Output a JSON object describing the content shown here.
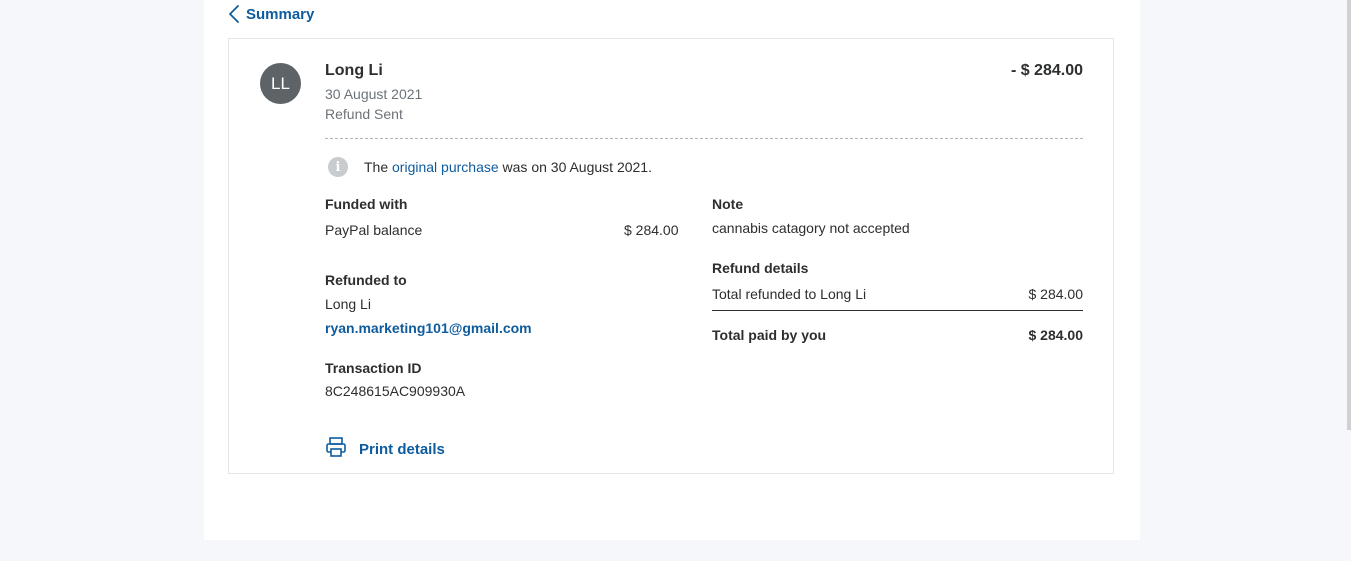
{
  "nav": {
    "back_label": "Summary"
  },
  "header": {
    "initials": "LL",
    "name": "Long Li",
    "date": "30 August 2021",
    "status": "Refund Sent",
    "amount": "- $ 284.00"
  },
  "info": {
    "prefix": "The ",
    "link": "original purchase",
    "suffix": " was on 30 August 2021."
  },
  "funded": {
    "label": "Funded with",
    "source": "PayPal balance",
    "amount": "$ 284.00"
  },
  "refunded_to": {
    "label": "Refunded to",
    "name": "Long Li",
    "email": "ryan.marketing101@gmail.com"
  },
  "transaction": {
    "label": "Transaction ID",
    "id": "8C248615AC909930A"
  },
  "note": {
    "label": "Note",
    "text": "cannabis catagory not accepted"
  },
  "refund_details": {
    "label": "Refund details",
    "row_label": "Total refunded to Long Li",
    "row_amount": "$ 284.00",
    "total_label": "Total paid by you",
    "total_amount": "$ 284.00"
  },
  "actions": {
    "print_label": "Print details"
  },
  "colors": {
    "link": "#0e5c9e",
    "avatar": "#5e6367",
    "text": "#2c2e2f",
    "muted": "#6c7378"
  },
  "icons": {
    "back": "chevron-left-icon",
    "info": "info-icon",
    "print": "printer-icon"
  }
}
